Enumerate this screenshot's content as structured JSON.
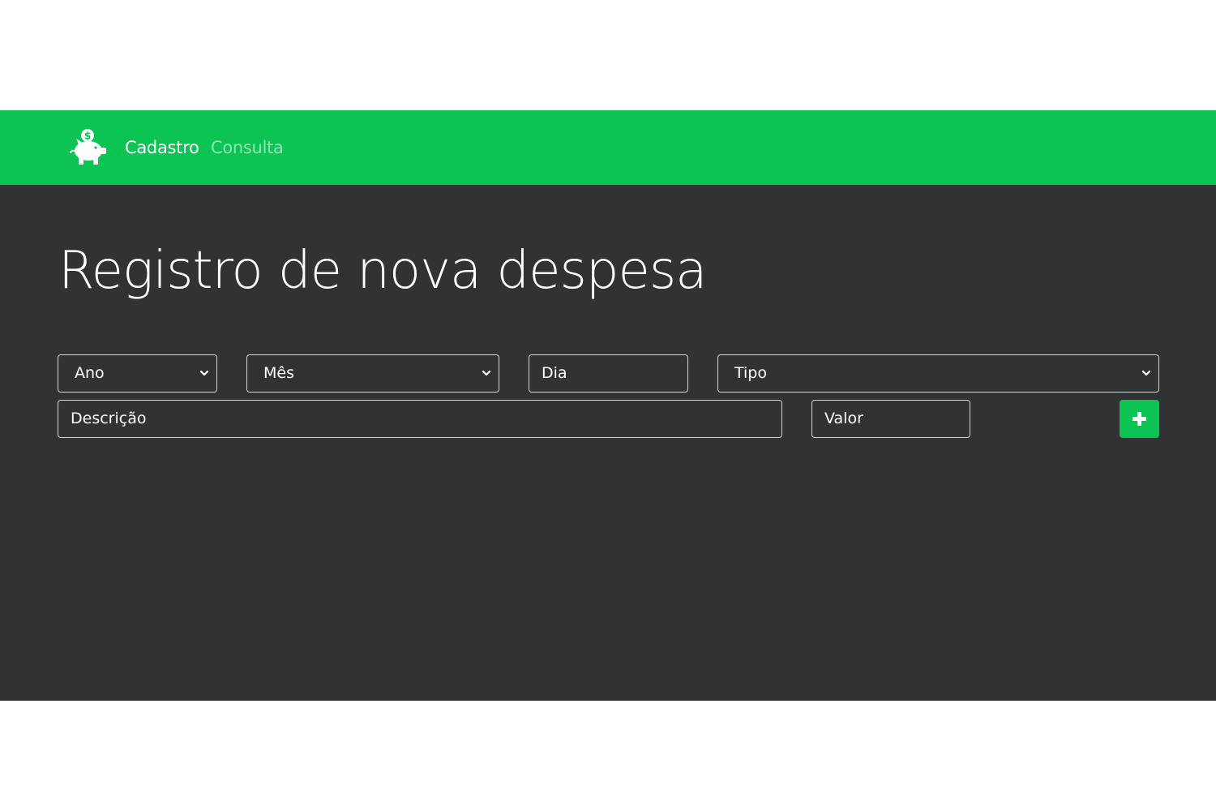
{
  "nav": {
    "logo_icon": "piggy-bank-icon",
    "links": [
      {
        "label": "Cadastro",
        "active": true
      },
      {
        "label": "Consulta",
        "active": false
      }
    ],
    "background_color": "#0cc453"
  },
  "main": {
    "title": "Registro de nova despesa",
    "background_color": "#313234"
  },
  "form": {
    "ano": {
      "value": "Ano",
      "type": "select"
    },
    "mes": {
      "value": "Mês",
      "type": "select"
    },
    "dia": {
      "placeholder": "Dia",
      "type": "input"
    },
    "tipo": {
      "value": "Tipo",
      "type": "select"
    },
    "descricao": {
      "placeholder": "Descrição",
      "type": "input"
    },
    "valor": {
      "placeholder": "Valor",
      "type": "input"
    },
    "add_button": {
      "icon": "plus-icon",
      "color": "#0cc453"
    }
  }
}
